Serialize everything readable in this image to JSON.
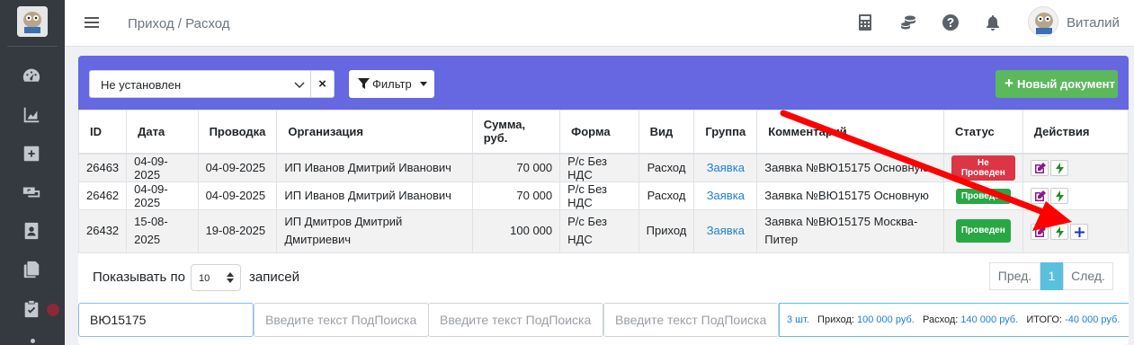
{
  "app": {
    "breadcrumb": "Приход / Расход",
    "user_name": "Виталий"
  },
  "filters": {
    "status_select": "Не установлен",
    "clear_label": "×",
    "filter_label": "Фильтр",
    "new_document_label": "Новый документ"
  },
  "table": {
    "headers": {
      "id": "ID",
      "date": "Дата",
      "posting": "Проводка",
      "org": "Организация",
      "sum": "Сумма, руб.",
      "form": "Форма",
      "kind": "Вид",
      "group": "Группа",
      "comment": "Комментарий",
      "status": "Статус",
      "actions": "Действия"
    },
    "rows": [
      {
        "id": "26463",
        "date": "04-09-2025",
        "posting": "04-09-2025",
        "org": "ИП Иванов Дмитрий Иванович",
        "sum": "70 000",
        "form": "Р/с Без НДС",
        "kind": "Расход",
        "group": "Заявка",
        "comment": "Заявка №ВЮ15175 Основную",
        "status": "Не Проведен"
      },
      {
        "id": "26462",
        "date": "04-09-2025",
        "posting": "04-09-2025",
        "org": "ИП Иванов Дмитрий Иванович",
        "sum": "70 000",
        "form": "Р/с Без НДС",
        "kind": "Расход",
        "group": "Заявка",
        "comment": "Заявка №ВЮ15175 Основную",
        "status": "Проведен"
      },
      {
        "id": "26432",
        "date": "15-08-2025",
        "posting": "19-08-2025",
        "org": "ИП Дмитров Дмитрий Дмитриевич",
        "sum": "100 000",
        "form": "Р/с Без НДС",
        "kind": "Приход",
        "group": "Заявка",
        "comment": "Заявка №ВЮ15175 Москва-Питер",
        "status": "Проведен"
      }
    ]
  },
  "pagination": {
    "show_prefix": "Показывать по",
    "per_page": "10",
    "show_suffix": "записей",
    "prev": "Пред.",
    "current": "1",
    "next": "След."
  },
  "search": {
    "field1_value": "ВЮ15175",
    "placeholder": "Введите текст ПодПоиска"
  },
  "totals": {
    "count": "3 шт.",
    "income_label": "Приход:",
    "income_value": "100 000 руб.",
    "expense_label": "Расход:",
    "expense_value": "140 000 руб.",
    "total_label": "ИТОГО:",
    "total_value": "-40 000 руб."
  },
  "colors": {
    "header_bar": "#6568e0",
    "new_doc_button": "#5cb85c",
    "badge_not_posted": "#dc3545",
    "badge_posted": "#28a745",
    "annotation_arrow": "#ff0000"
  },
  "icons": {
    "sidebar": [
      "dashboard-icon",
      "chart-icon",
      "plus-square-icon",
      "money-exchange-icon",
      "contact-card-icon",
      "copy-icon",
      "clipboard-check-icon"
    ],
    "navbar": [
      "calculator-icon",
      "coins-icon",
      "help-icon",
      "bell-icon"
    ],
    "row_actions": [
      "edit-icon",
      "bolt-icon",
      "plus-icon"
    ]
  }
}
